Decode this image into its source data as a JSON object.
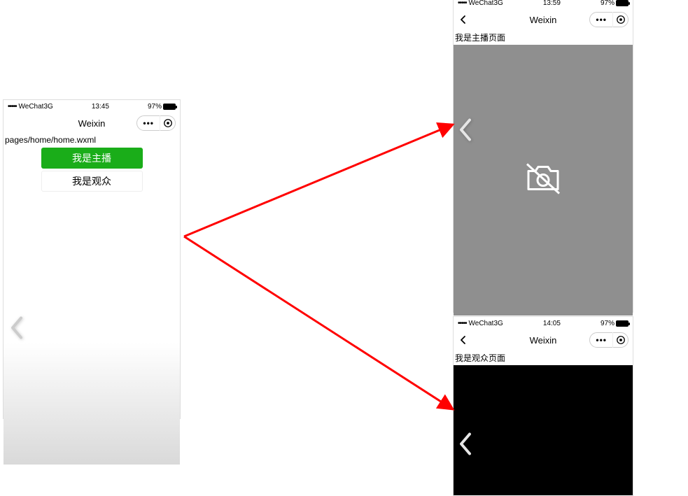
{
  "phoneA": {
    "status": {
      "carrier": "WeChat3G",
      "time": "13:45",
      "battery": "97%"
    },
    "title": "Weixin",
    "page_path": "pages/home/home.wxml",
    "btn_primary": "我是主播",
    "btn_secondary": "我是观众"
  },
  "phoneB": {
    "status": {
      "carrier": "WeChat3G",
      "time": "13:59",
      "battery": "97%"
    },
    "title": "Weixin",
    "page_label": "我是主播页面"
  },
  "phoneC": {
    "status": {
      "carrier": "WeChat3G",
      "time": "14:05",
      "battery": "97%"
    },
    "title": "Weixin",
    "page_label": "我是观众页面"
  }
}
